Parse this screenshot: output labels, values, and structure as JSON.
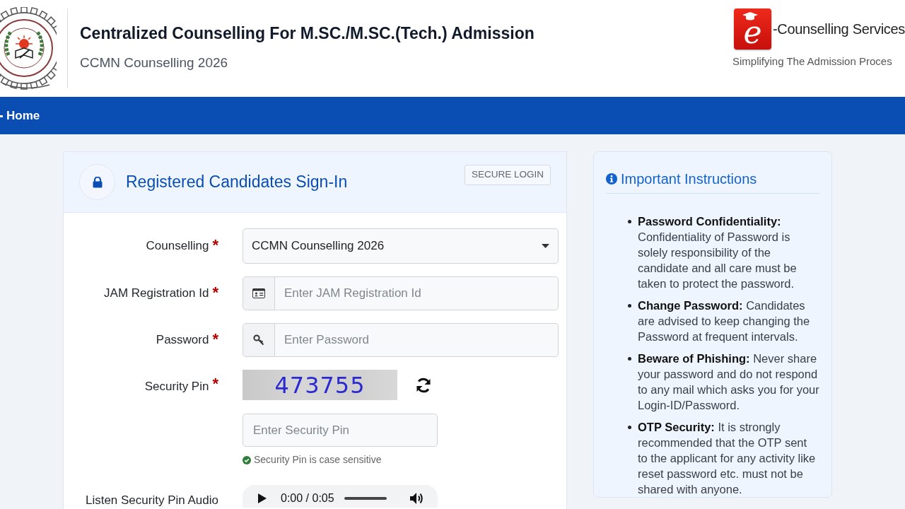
{
  "header": {
    "title": "Centralized Counselling For M.SC./M.SC.(Tech.) Admission",
    "subtitle": "CCMN Counselling 2026",
    "partner_logo": {
      "letter": "e",
      "name": "-Counselling Services",
      "tagline": "Simplifying The Admission Proces"
    }
  },
  "nav": {
    "items": [
      {
        "label": "Home"
      }
    ]
  },
  "login_card": {
    "title": "Registered Candidates Sign-In",
    "badge": "SECURE LOGIN",
    "fields": [
      {
        "kind": "select",
        "label": "Counselling",
        "required_mark": "*",
        "value": "CCMN Counselling 2026"
      },
      {
        "kind": "id",
        "label": "JAM Registration Id",
        "required_mark": "*",
        "placeholder": "Enter JAM Registration Id"
      },
      {
        "kind": "password",
        "label": "Password",
        "required_mark": "*",
        "placeholder": "Enter Password"
      },
      {
        "kind": "captcha",
        "label": "Security Pin",
        "required_mark": "*",
        "captcha_text": "473755",
        "placeholder": "Enter Security Pin",
        "hint": "Security Pin is case sensitive"
      },
      {
        "kind": "audio",
        "label": "Listen Security Pin Audio",
        "time": "0:00 / 0:05"
      }
    ]
  },
  "instructions": {
    "title": "Important Instructions",
    "items": [
      "**Password Confidentiality:** Confidentiality of Password is solely responsibility of the candidate and all care must be taken to protect the password.",
      "**Change Password:** Candidates are advised to keep changing the Password at frequent intervals.",
      "**Beware of Phishing:** Never share your password and do not respond to any mail which asks you for your Login-ID/Password.",
      "**OTP Security:** It is strongly recommended that the OTP sent to the applicant for any activity like reset password etc. must not be shared with anyone."
    ]
  }
}
